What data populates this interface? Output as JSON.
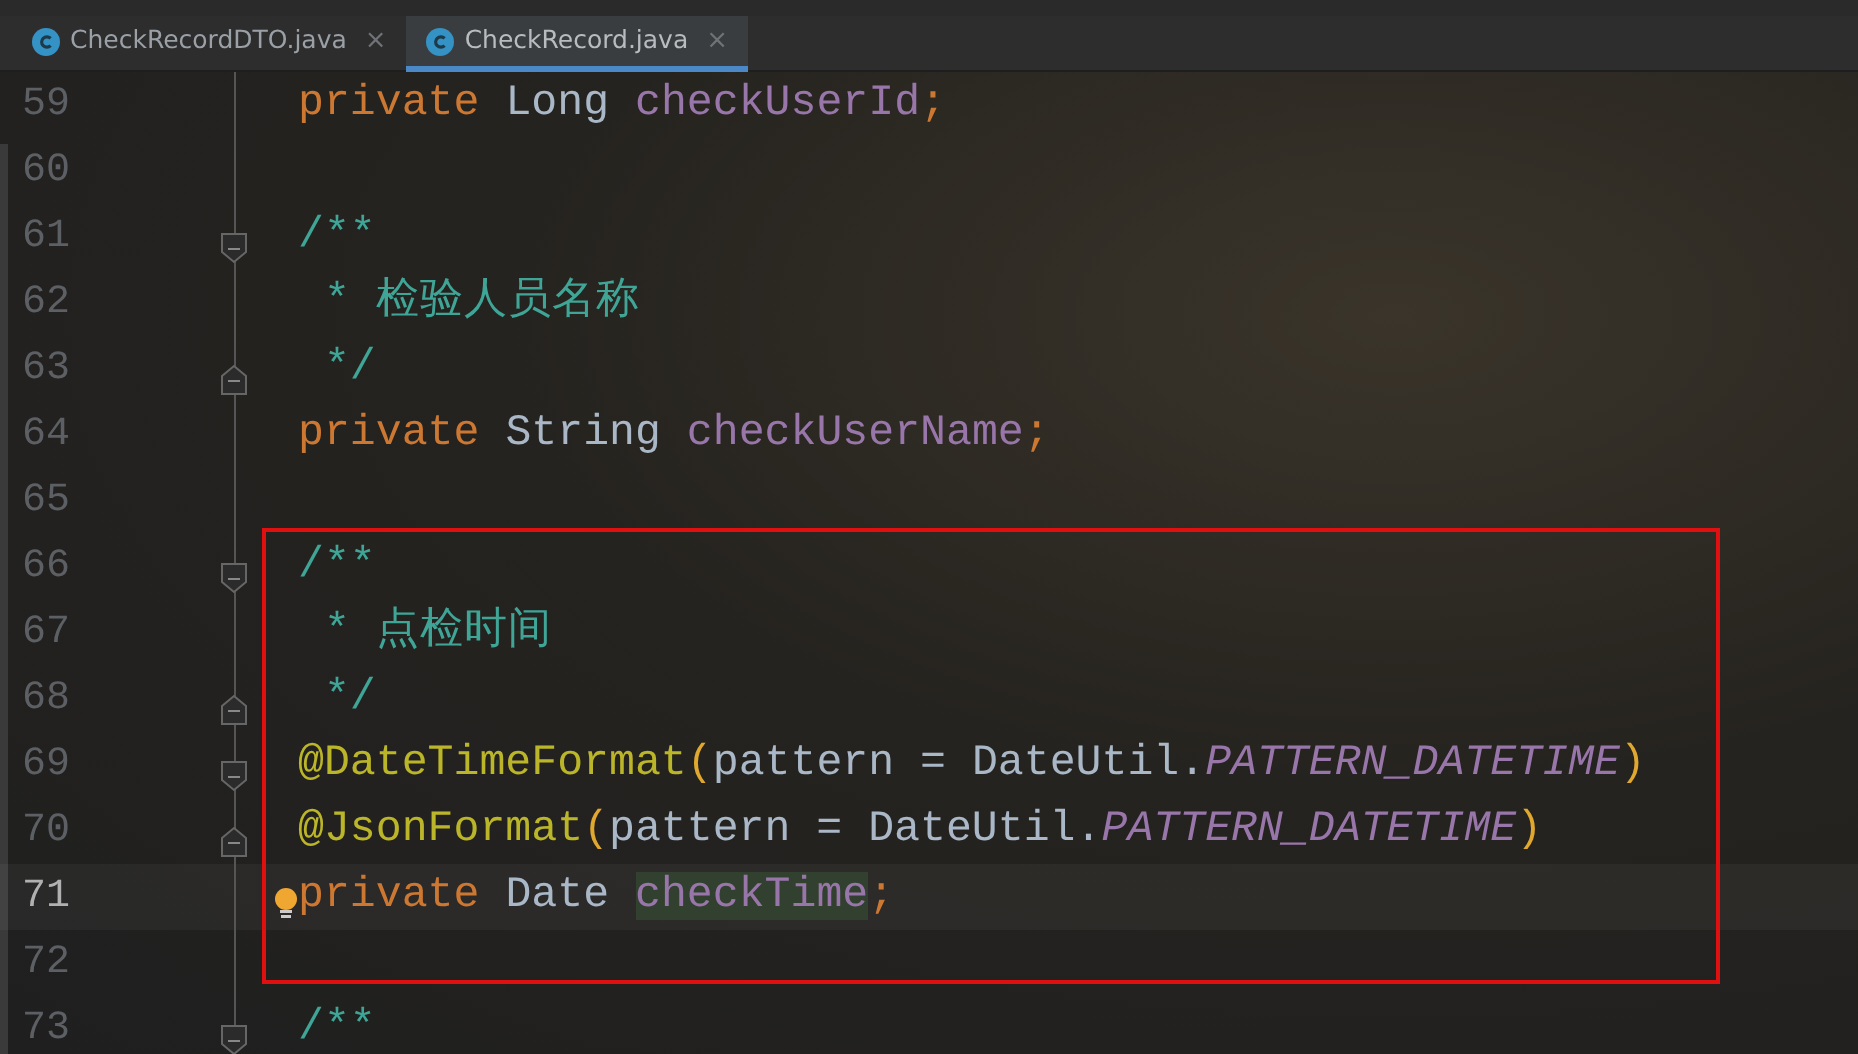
{
  "tabs": [
    {
      "label": "CheckRecordDTO.java",
      "close": "×",
      "selected": false
    },
    {
      "label": "CheckRecord.java",
      "close": "×",
      "selected": true
    }
  ],
  "blocks": [
    {
      "boxed": false,
      "lines": [
        {
          "number": "59",
          "tokens": [
            {
              "kind": "keyword",
              "text": "private"
            },
            {
              "kind": "type",
              "text": "Long"
            },
            {
              "kind": "field",
              "text": "checkUserId"
            },
            {
              "kind": "punct",
              "text": ";"
            }
          ]
        },
        {
          "number": "60"
        },
        {
          "number": "61",
          "fold_start": true,
          "tokens": [
            {
              "kind": "comment",
              "text": "/**"
            }
          ]
        },
        {
          "number": "62",
          "tokens": [
            {
              "kind": "comment",
              "text": " * 检验人员名称"
            }
          ]
        },
        {
          "number": "63",
          "fold_end": true,
          "tokens": [
            {
              "kind": "comment",
              "text": " */"
            }
          ]
        },
        {
          "number": "64",
          "tokens": [
            {
              "kind": "keyword",
              "text": "private"
            },
            {
              "kind": "type",
              "text": "String"
            },
            {
              "kind": "field",
              "text": "checkUserName"
            },
            {
              "kind": "punct",
              "text": ";"
            }
          ]
        },
        {
          "number": "65"
        }
      ]
    },
    {
      "boxed": true,
      "lines": [
        {
          "number": "66",
          "fold_start": true,
          "tokens": [
            {
              "kind": "comment",
              "text": "/**"
            }
          ]
        },
        {
          "number": "67",
          "tokens": [
            {
              "kind": "comment",
              "text": " * 点检时间"
            }
          ]
        },
        {
          "number": "68",
          "fold_end": true,
          "tokens": [
            {
              "kind": "comment",
              "text": " */"
            }
          ]
        },
        {
          "number": "69",
          "fold_start": true,
          "tokens": [
            {
              "kind": "annotation",
              "text": "@DateTimeFormat"
            },
            {
              "kind": "paren",
              "text": "("
            },
            {
              "kind": "plain",
              "text": "pattern = DateUtil."
            },
            {
              "kind": "constant",
              "text": "PATTERN_DATETIME"
            },
            {
              "kind": "paren",
              "text": ")"
            }
          ]
        },
        {
          "number": "70",
          "fold_end": true,
          "tokens": [
            {
              "kind": "annotation",
              "text": "@JsonFormat"
            },
            {
              "kind": "paren",
              "text": "("
            },
            {
              "kind": "plain",
              "text": "pattern = DateUtil."
            },
            {
              "kind": "constant",
              "text": "PATTERN_DATETIME"
            },
            {
              "kind": "paren",
              "text": ")"
            }
          ]
        },
        {
          "number": "71",
          "current": true,
          "bulb": true,
          "tokens": [
            {
              "kind": "keyword",
              "text": "private"
            },
            {
              "kind": "type",
              "text": "Date"
            },
            {
              "kind": "field",
              "text": "checkTime",
              "highlighted": true
            },
            {
              "kind": "punct",
              "text": ";"
            }
          ]
        },
        {
          "number": "72"
        }
      ]
    },
    {
      "boxed": false,
      "lines": [
        {
          "number": "73",
          "fold_start": true,
          "tokens": [
            {
              "kind": "comment",
              "text": "/**"
            }
          ]
        }
      ]
    }
  ]
}
